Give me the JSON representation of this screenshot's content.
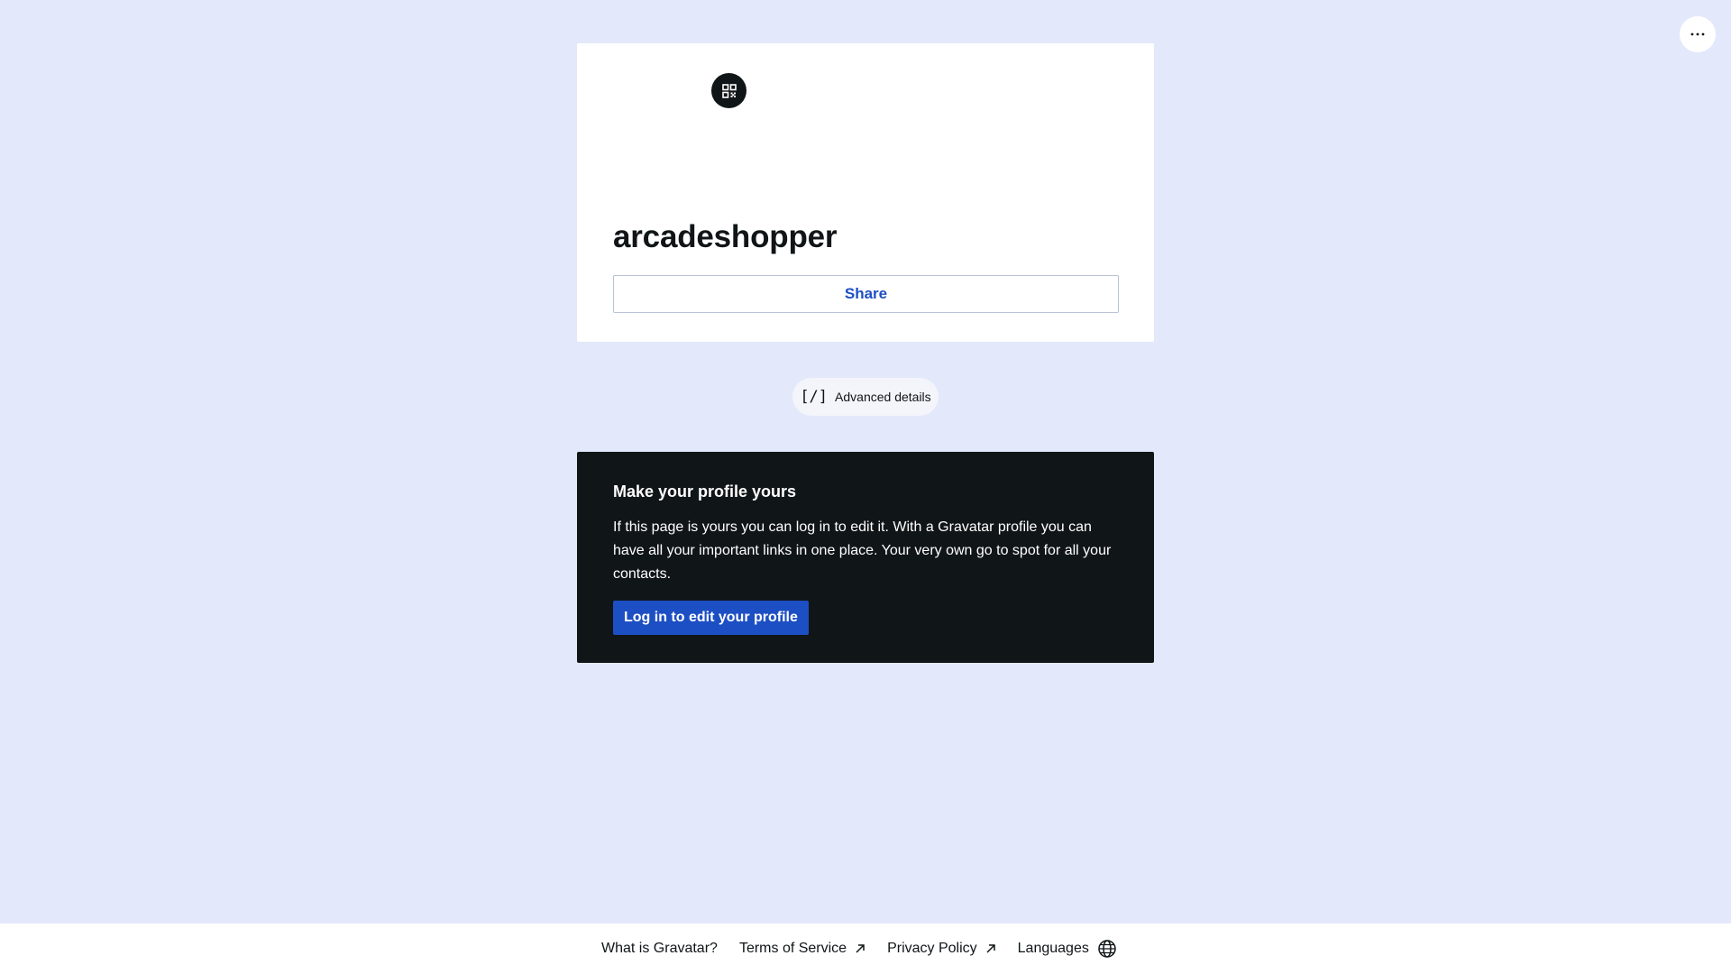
{
  "header": {
    "menu_icon": "more-horizontal-icon"
  },
  "profile": {
    "qr_icon": "qr-code-icon",
    "username": "arcadeshopper",
    "share_label": "Share"
  },
  "advanced": {
    "icon_text": "[/]",
    "label": "Advanced details"
  },
  "cta": {
    "title": "Make your profile yours",
    "body": "If this page is yours you can log in to edit it. With a Gravatar profile you can have all your important links in one place. Your very own go to spot for all your contacts.",
    "button_label": "Log in to edit your profile"
  },
  "footer": {
    "links": [
      {
        "label": "What is Gravatar?",
        "icon": ""
      },
      {
        "label": "Terms of Service",
        "icon": "external-arrow-icon"
      },
      {
        "label": "Privacy Policy",
        "icon": "external-arrow-icon"
      },
      {
        "label": "Languages",
        "icon": "globe-icon"
      }
    ]
  },
  "colors": {
    "background": "#e3e9fa",
    "accent": "#1d4fc4",
    "dark": "#101517"
  }
}
